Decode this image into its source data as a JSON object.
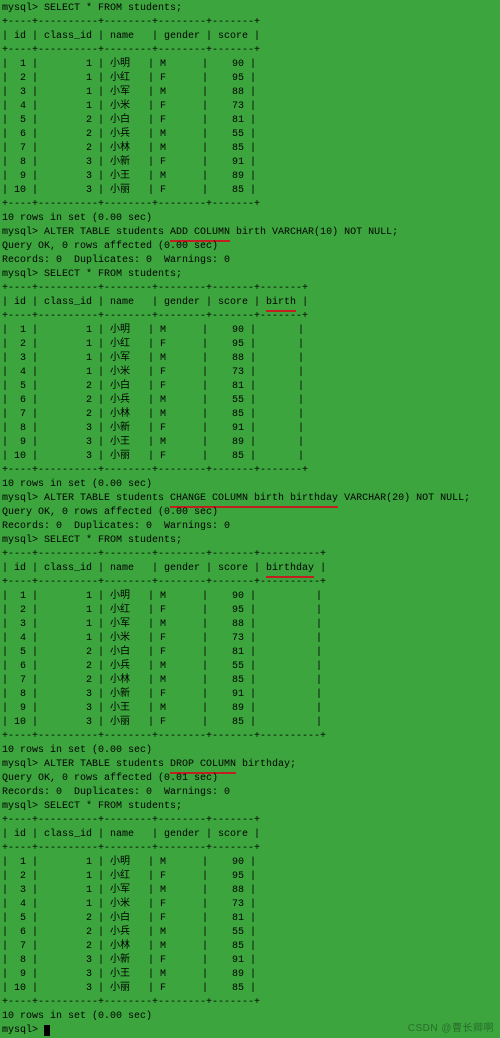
{
  "prompt": "mysql>",
  "sql_select": "SELECT * FROM students;",
  "footer": "10 rows in set (0.00 sec)",
  "cmd_add": {
    "pre": "ALTER TABLE students ",
    "u": "ADD COLUMN",
    "post": " birth VARCHAR(10) NOT NULL;"
  },
  "cmd_change": {
    "pre": "ALTER TABLE students ",
    "u": "CHANGE COLUMN birth birthday",
    "post": " VARCHAR(20) NOT NULL;"
  },
  "cmd_drop": {
    "pre": "ALTER TABLE students ",
    "u": "DROP COLUMN",
    "post": " birthday;"
  },
  "resp_ok_000": "Query OK, 0 rows affected (0.00 sec)",
  "resp_ok_001": "Query OK, 0 rows affected (0.01 sec)",
  "resp_records": "Records: 0  Duplicates: 0  Warnings: 0",
  "cols5": {
    "sep": "+----+----------+--------+--------+-------+",
    "hdr": "| id | class_id | name   | gender | score |"
  },
  "cols6_birth": {
    "sep": "+----+----------+--------+--------+-------+-------+",
    "hdr_pre": "| id | class_id | name   | gender | score | ",
    "hdr_u": "birth",
    "hdr_post": " |"
  },
  "cols6_birthday": {
    "sep": "+----+----------+--------+--------+-------+----------+",
    "hdr_pre": "| id | class_id | name   | gender | score | ",
    "hdr_u": "birthday",
    "hdr_post": " |"
  },
  "rows5": [
    "|  1 |        1 | 小明   | M      |    90 |",
    "|  2 |        1 | 小红   | F      |    95 |",
    "|  3 |        1 | 小军   | M      |    88 |",
    "|  4 |        1 | 小米   | F      |    73 |",
    "|  5 |        2 | 小白   | F      |    81 |",
    "|  6 |        2 | 小兵   | M      |    55 |",
    "|  7 |        2 | 小林   | M      |    85 |",
    "|  8 |        3 | 小新   | F      |    91 |",
    "|  9 |        3 | 小王   | M      |    89 |",
    "| 10 |        3 | 小丽   | F      |    85 |"
  ],
  "rows6_birth": [
    "|  1 |        1 | 小明   | M      |    90 |       |",
    "|  2 |        1 | 小红   | F      |    95 |       |",
    "|  3 |        1 | 小军   | M      |    88 |       |",
    "|  4 |        1 | 小米   | F      |    73 |       |",
    "|  5 |        2 | 小白   | F      |    81 |       |",
    "|  6 |        2 | 小兵   | M      |    55 |       |",
    "|  7 |        2 | 小林   | M      |    85 |       |",
    "|  8 |        3 | 小新   | F      |    91 |       |",
    "|  9 |        3 | 小王   | M      |    89 |       |",
    "| 10 |        3 | 小丽   | F      |    85 |       |"
  ],
  "rows6_birthday": [
    "|  1 |        1 | 小明   | M      |    90 |          |",
    "|  2 |        1 | 小红   | F      |    95 |          |",
    "|  3 |        1 | 小军   | M      |    88 |          |",
    "|  4 |        1 | 小米   | F      |    73 |          |",
    "|  5 |        2 | 小白   | F      |    81 |          |",
    "|  6 |        2 | 小兵   | M      |    55 |          |",
    "|  7 |        2 | 小林   | M      |    85 |          |",
    "|  8 |        3 | 小新   | F      |    91 |          |",
    "|  9 |        3 | 小王   | M      |    89 |          |",
    "| 10 |        3 | 小丽   | F      |    85 |          |"
  ],
  "watermark": "CSDN @曹长卿啊",
  "chart_data": {
    "type": "table",
    "columns": [
      "id",
      "class_id",
      "name",
      "gender",
      "score"
    ],
    "rows": [
      {
        "id": 1,
        "class_id": 1,
        "name": "小明",
        "gender": "M",
        "score": 90
      },
      {
        "id": 2,
        "class_id": 1,
        "name": "小红",
        "gender": "F",
        "score": 95
      },
      {
        "id": 3,
        "class_id": 1,
        "name": "小军",
        "gender": "M",
        "score": 88
      },
      {
        "id": 4,
        "class_id": 1,
        "name": "小米",
        "gender": "F",
        "score": 73
      },
      {
        "id": 5,
        "class_id": 2,
        "name": "小白",
        "gender": "F",
        "score": 81
      },
      {
        "id": 6,
        "class_id": 2,
        "name": "小兵",
        "gender": "M",
        "score": 55
      },
      {
        "id": 7,
        "class_id": 2,
        "name": "小林",
        "gender": "M",
        "score": 85
      },
      {
        "id": 8,
        "class_id": 3,
        "name": "小新",
        "gender": "F",
        "score": 91
      },
      {
        "id": 9,
        "class_id": 3,
        "name": "小王",
        "gender": "M",
        "score": 89
      },
      {
        "id": 10,
        "class_id": 3,
        "name": "小丽",
        "gender": "F",
        "score": 85
      }
    ]
  }
}
